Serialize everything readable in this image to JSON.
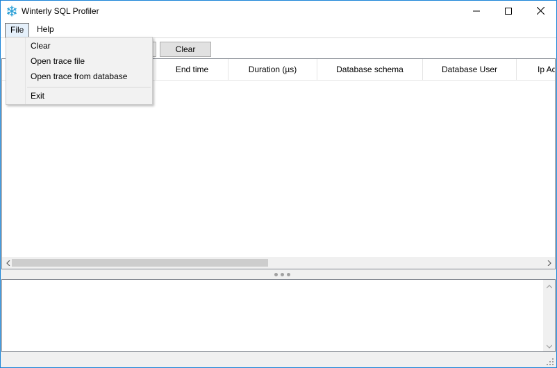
{
  "window": {
    "title": "Winterly SQL Profiler",
    "accent_color": "#1883d7",
    "app_icon": "snowflake-icon",
    "controls": [
      "minimize-icon",
      "maximize-icon",
      "close-icon"
    ]
  },
  "menubar": {
    "items": [
      {
        "label": "File",
        "open": true
      },
      {
        "label": "Help",
        "open": false
      }
    ]
  },
  "file_menu": {
    "items": [
      "Clear",
      "Open trace file",
      "Open trace from database",
      "Exit"
    ]
  },
  "toolbar": {
    "clear_label": "Clear"
  },
  "grid": {
    "columns": [
      "",
      "End time",
      "Duration (µs)",
      "Database schema",
      "Database User",
      "Ip Ad"
    ],
    "rows": []
  },
  "detail": {
    "text": ""
  }
}
